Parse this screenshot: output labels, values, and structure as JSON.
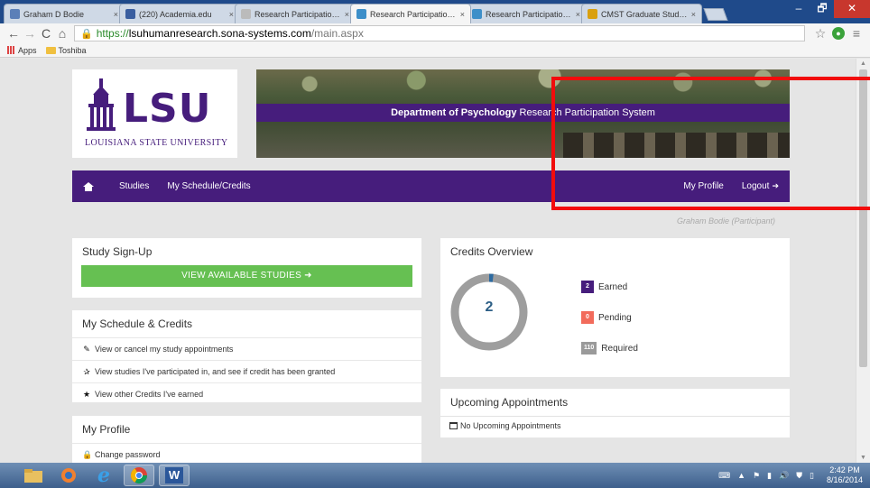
{
  "browser": {
    "tabs": [
      {
        "title": "Graham D Bodie",
        "fav": "#5b7fb8",
        "active": false
      },
      {
        "title": "(220) Academia.edu",
        "fav": "#3b5fa0",
        "active": false
      },
      {
        "title": "Research Participation Sto",
        "fav": "#bbbbbb",
        "active": false
      },
      {
        "title": "Research Participation Sys",
        "fav": "#3d8fc9",
        "active": true
      },
      {
        "title": "Research Participation Sys",
        "fav": "#3d8fc9",
        "active": false
      },
      {
        "title": "CMST Graduate Student A",
        "fav": "#d9a010",
        "active": false
      }
    ],
    "tab_close": "×",
    "url_scheme": "https://",
    "url_host": "lsuhumanresearch.sona-systems.com",
    "url_path": "/main.aspx",
    "bookmarks": [
      "Apps",
      "Toshiba"
    ],
    "window_controls": {
      "minimize": "–",
      "maximize": "🗗",
      "close": "✕"
    }
  },
  "site": {
    "logo_text": "LSU",
    "university": "LOUISIANA STATE UNIVERSITY",
    "banner_bold": "Department of Psychology",
    "banner_rest": " Research Participation System",
    "nav": {
      "studies": "Studies",
      "schedule": "My Schedule/Credits",
      "profile": "My Profile",
      "logout": "Logout"
    },
    "user_line": "Graham Bodie (Participant)"
  },
  "signup": {
    "title": "Study Sign-Up",
    "button": "VIEW AVAILABLE STUDIES ➜"
  },
  "schedule": {
    "title": "My Schedule & Credits",
    "items": [
      {
        "icon": "edit-icon",
        "glyph": "✎",
        "text": "View or cancel my study appointments"
      },
      {
        "icon": "star-half-icon",
        "glyph": "✰",
        "text": "View studies I've participated in, and see if credit has been granted"
      },
      {
        "icon": "star-icon",
        "glyph": "★",
        "text": "View other Credits I've earned"
      }
    ]
  },
  "profile": {
    "title": "My Profile",
    "change_password": "Change password"
  },
  "credits": {
    "title": "Credits Overview",
    "earned_value": 2,
    "required_value": 110,
    "donut_label": "2",
    "rows": [
      {
        "badge": "2",
        "label": "Earned",
        "color": "#461d7c"
      },
      {
        "badge": "0",
        "label": "Pending",
        "color": "#f26b5b"
      },
      {
        "badge": "110",
        "label": "Required",
        "color": "#9a9a9a"
      }
    ]
  },
  "appointments": {
    "title": "Upcoming Appointments",
    "empty": "No Upcoming Appointments"
  },
  "taskbar": {
    "time": "2:42 PM",
    "date": "8/16/2014"
  }
}
